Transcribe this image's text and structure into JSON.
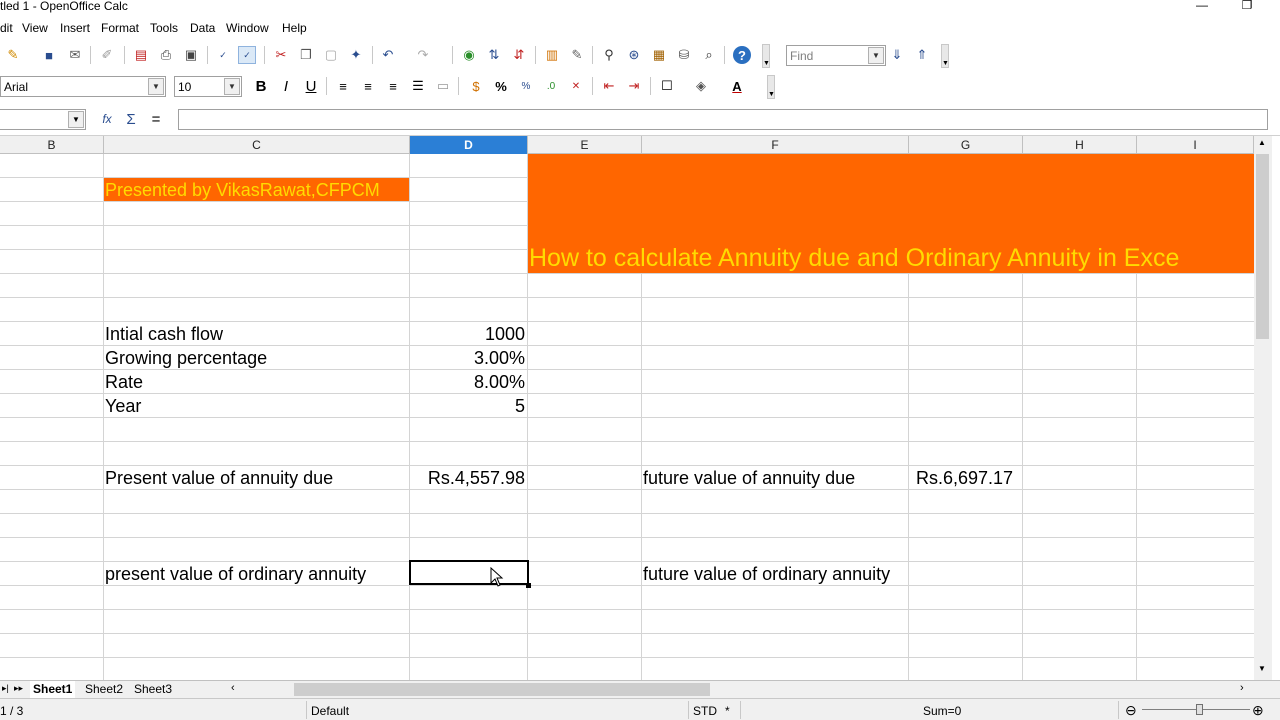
{
  "window": {
    "title": "tled 1 - OpenOffice Calc",
    "minimize_glyph": "—",
    "restore_glyph": "❐"
  },
  "menu": {
    "items": [
      "dit",
      "View",
      "Insert",
      "Format",
      "Tools",
      "Data",
      "Window",
      "Help"
    ]
  },
  "toolbar": {
    "find_placeholder": "Find",
    "font_name": "Arial",
    "font_size": "10",
    "bold_label": "B",
    "italic_label": "I",
    "underline_label": "U",
    "percent_label": "%",
    "help_label": "?",
    "font_color_label": "A"
  },
  "formula_bar": {
    "function_wizard_label": "fx",
    "sum_label": "Σ",
    "equals_label": "=",
    "namebox_value": "",
    "formula_value": ""
  },
  "columns": [
    "B",
    "C",
    "D",
    "E",
    "F",
    "G",
    "H",
    "I"
  ],
  "active_column": "D",
  "cells": {
    "presenter": "Presented by VikasRawat,CFPCM",
    "banner": "How to calculate Annuity due and Ordinary Annuity in Exce",
    "initial_cash_flow_label": "Intial cash flow",
    "initial_cash_flow_value": "1000",
    "growing_percentage_label": "Growing percentage",
    "growing_percentage_value": "3.00%",
    "rate_label": "Rate",
    "rate_value": "8.00%",
    "year_label": "Year",
    "year_value": "5",
    "pv_due_label": "Present value of annuity due",
    "pv_due_value": "Rs.4,557.98",
    "fv_due_label": "future value of annuity due",
    "fv_due_value": "Rs.6,697.17",
    "pv_ordinary_label": "present value of ordinary annuity",
    "fv_ordinary_label": "future value of ordinary annuity"
  },
  "sheets": [
    "Sheet1",
    "Sheet2",
    "Sheet3"
  ],
  "active_sheet": "Sheet1",
  "status": {
    "page": "1 / 3",
    "page_style": "Default",
    "selection_mode": "STD",
    "modified": "*",
    "sum": "Sum=0"
  },
  "colors": {
    "banner_bg": "#ff6600",
    "banner_text": "#ffdb00",
    "active_column_header": "#2b7fd6"
  }
}
